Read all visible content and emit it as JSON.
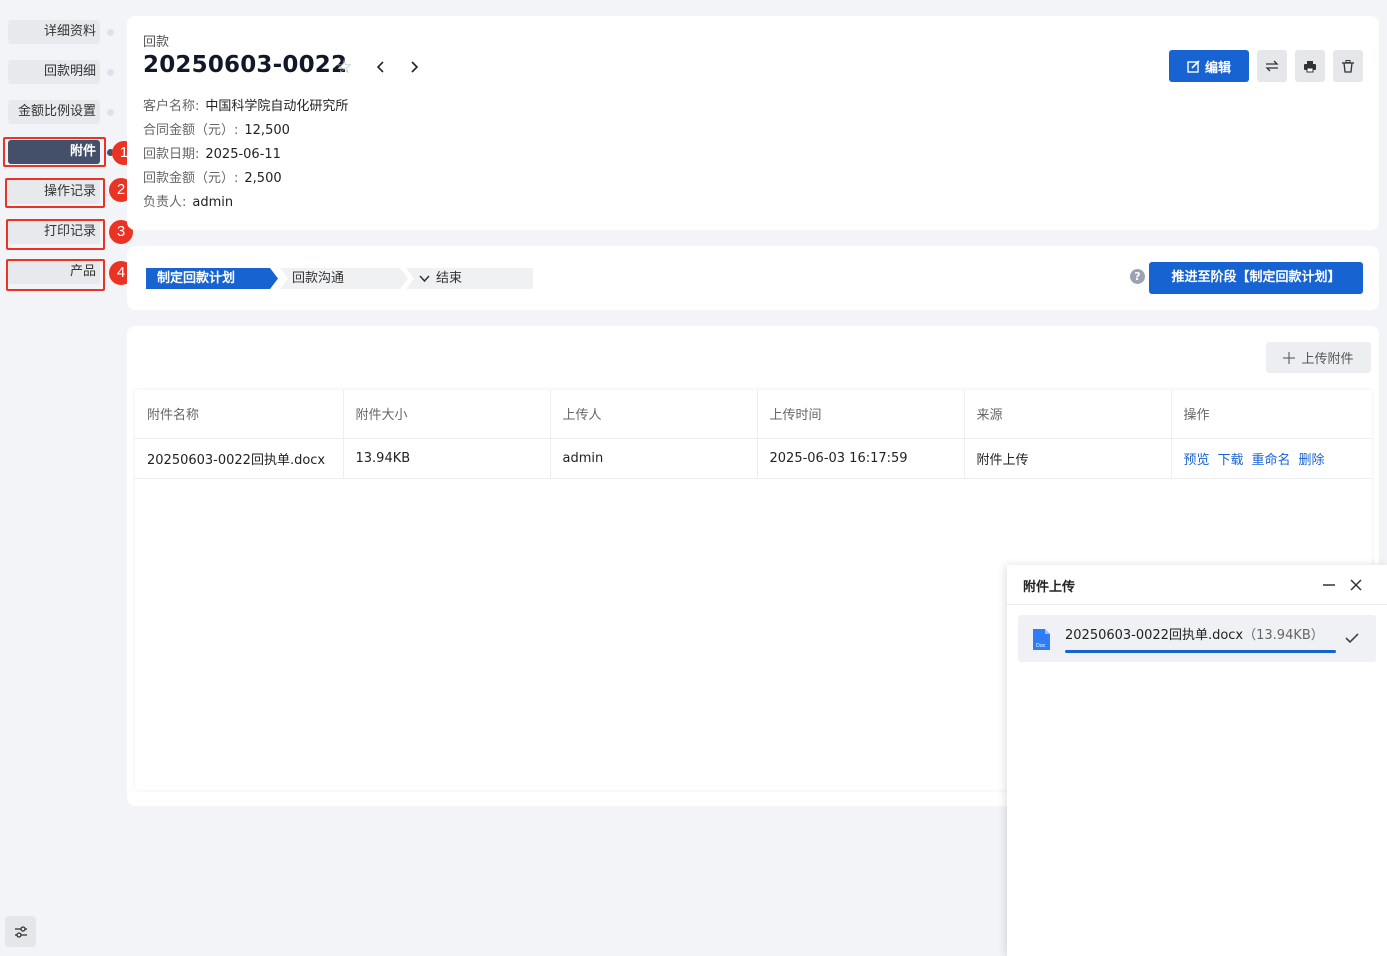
{
  "anchor_nav": {
    "items": [
      {
        "label": "详细资料",
        "active": false
      },
      {
        "label": "回款明细",
        "active": false
      },
      {
        "label": "金额比例设置",
        "active": false
      },
      {
        "label": "附件",
        "active": true
      },
      {
        "label": "操作记录",
        "active": false
      },
      {
        "label": "打印记录",
        "active": false
      },
      {
        "label": "产品",
        "active": false
      }
    ],
    "annotations": [
      "1",
      "2",
      "3",
      "4"
    ],
    "settings_icon": "sliders-icon"
  },
  "header": {
    "module": "回款",
    "title": "20250603-0022",
    "star_icon": "star-outline-icon",
    "fields": [
      {
        "label": "客户名称:",
        "value": "中国科学院自动化研究所"
      },
      {
        "label": "合同金额（元）:",
        "value": "12,500"
      },
      {
        "label": "回款日期:",
        "value": "2025-06-11"
      },
      {
        "label": "回款金额（元）:",
        "value": "2,500"
      },
      {
        "label": "负责人:",
        "value": "admin"
      }
    ],
    "edit_label": "编辑",
    "tool_icons": [
      "transfer-icon",
      "print-icon",
      "delete-icon"
    ]
  },
  "stages": {
    "items": [
      "制定回款计划",
      "回款沟通",
      "结束"
    ],
    "current": "制定回款计划",
    "advance_label": "推进至阶段【制定回款计划】"
  },
  "attachments": {
    "upload_label": "上传附件",
    "columns": [
      "附件名称",
      "附件大小",
      "上传人",
      "上传时间",
      "来源",
      "操作"
    ],
    "rows": [
      {
        "name": "20250603-0022回执单.docx",
        "size": "13.94KB",
        "uploader": "admin",
        "time": "2025-06-03 16:17:59",
        "source": "附件上传"
      }
    ],
    "actions": [
      "预览",
      "下载",
      "重命名",
      "删除"
    ]
  },
  "upload_panel": {
    "title": "附件上传",
    "file_name": "20250603-0022回执单.docx",
    "file_size": "（13.94KB）",
    "file_icon_text": "Doc",
    "progress": 1.0,
    "status": "complete"
  },
  "colors": {
    "primary": "#1763d1",
    "nav_active": "#44506a",
    "annotation": "#ea3323",
    "background": "#f2f4f7"
  }
}
